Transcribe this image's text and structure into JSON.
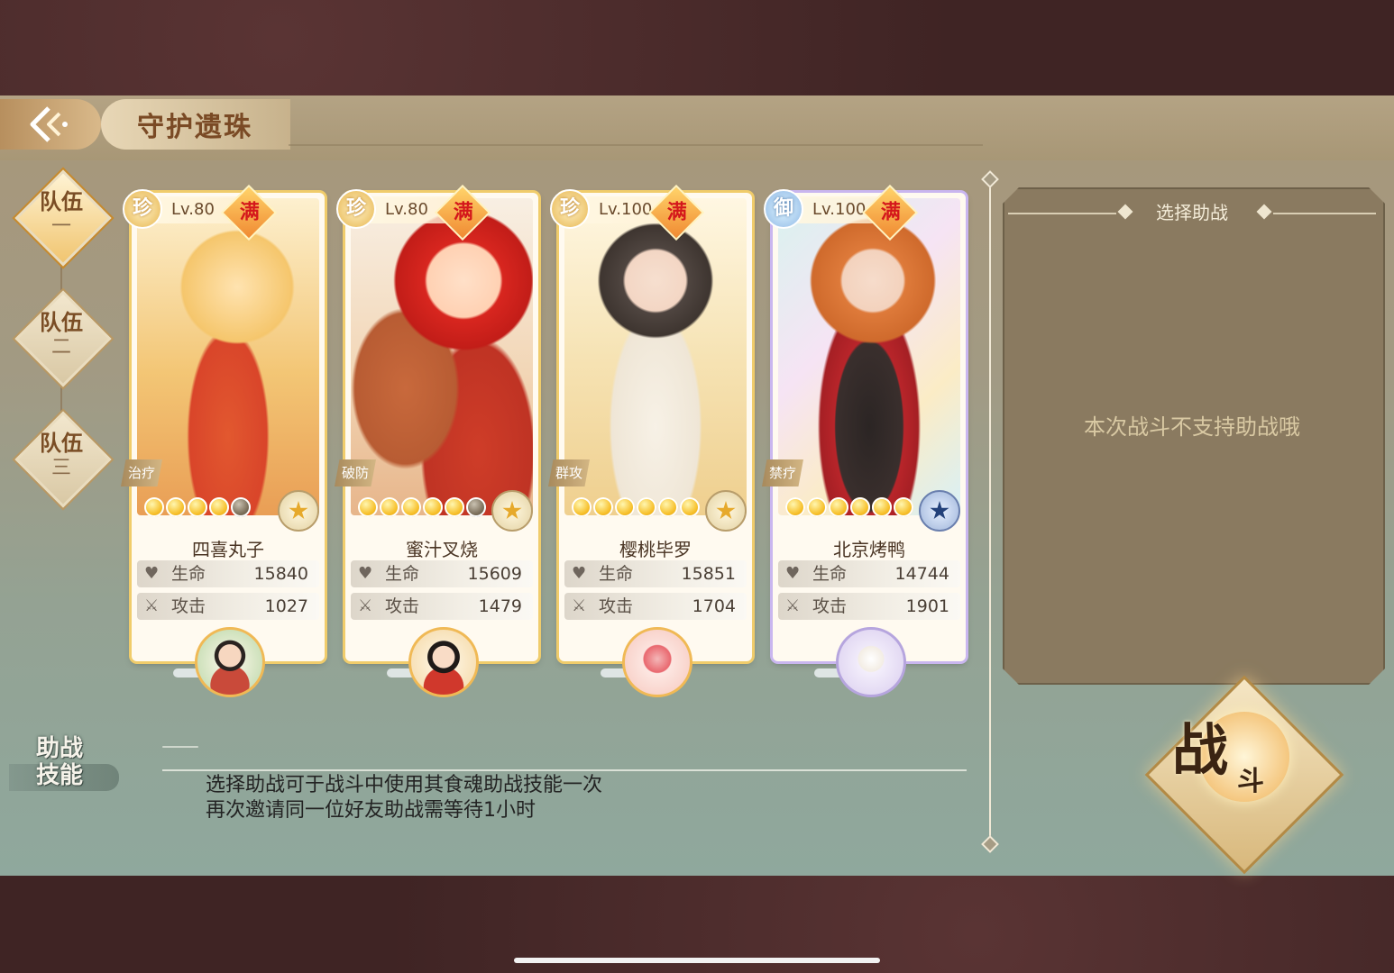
{
  "header": {
    "title": "守护遗珠"
  },
  "teams": [
    {
      "label": "队伍",
      "num": "一",
      "active": true
    },
    {
      "label": "队伍",
      "num": "二",
      "active": false
    },
    {
      "label": "队伍",
      "num": "三",
      "active": false
    }
  ],
  "cards": [
    {
      "rarity": "珍",
      "level": "Lv.80",
      "max": "满",
      "role": "治疗",
      "stars": 4,
      "star_slots": 5,
      "name": "四喜丸子",
      "hp_label": "生命",
      "hp": "15840",
      "atk_label": "攻击",
      "atk": "1027",
      "element_icon": "gold-flower-icon",
      "border_color": "#f0cc6b"
    },
    {
      "rarity": "珍",
      "level": "Lv.80",
      "max": "满",
      "role": "破防",
      "stars": 5,
      "star_slots": 6,
      "name": "蜜汁叉烧",
      "hp_label": "生命",
      "hp": "15609",
      "atk_label": "攻击",
      "atk": "1479",
      "element_icon": "gold-flower-icon",
      "border_color": "#f0cc6b"
    },
    {
      "rarity": "珍",
      "level": "Lv.100",
      "max": "满",
      "role": "群攻",
      "stars": 6,
      "star_slots": 6,
      "name": "樱桃毕罗",
      "hp_label": "生命",
      "hp": "15851",
      "atk_label": "攻击",
      "atk": "1704",
      "element_icon": "gold-flower-icon",
      "border_color": "#f0cc6b"
    },
    {
      "rarity": "御",
      "level": "Lv.100",
      "max": "满",
      "role": "禁疗",
      "stars": 6,
      "star_slots": 6,
      "name": "北京烤鸭",
      "hp_label": "生命",
      "hp": "14744",
      "atk_label": "攻击",
      "atk": "1901",
      "element_icon": "blue-flower-icon",
      "border_color": "#c9b6ef"
    }
  ],
  "support": {
    "header": "选择助战",
    "message": "本次战斗不支持助战哦"
  },
  "assist": {
    "title_line1": "助战",
    "title_line2": "技能",
    "desc_line1": "选择助战可于战斗中使用其食魂助战技能一次",
    "desc_line2": "再次邀请同一位好友助战需等待1小时"
  },
  "fight_button": {
    "big": "战",
    "small": "斗"
  }
}
